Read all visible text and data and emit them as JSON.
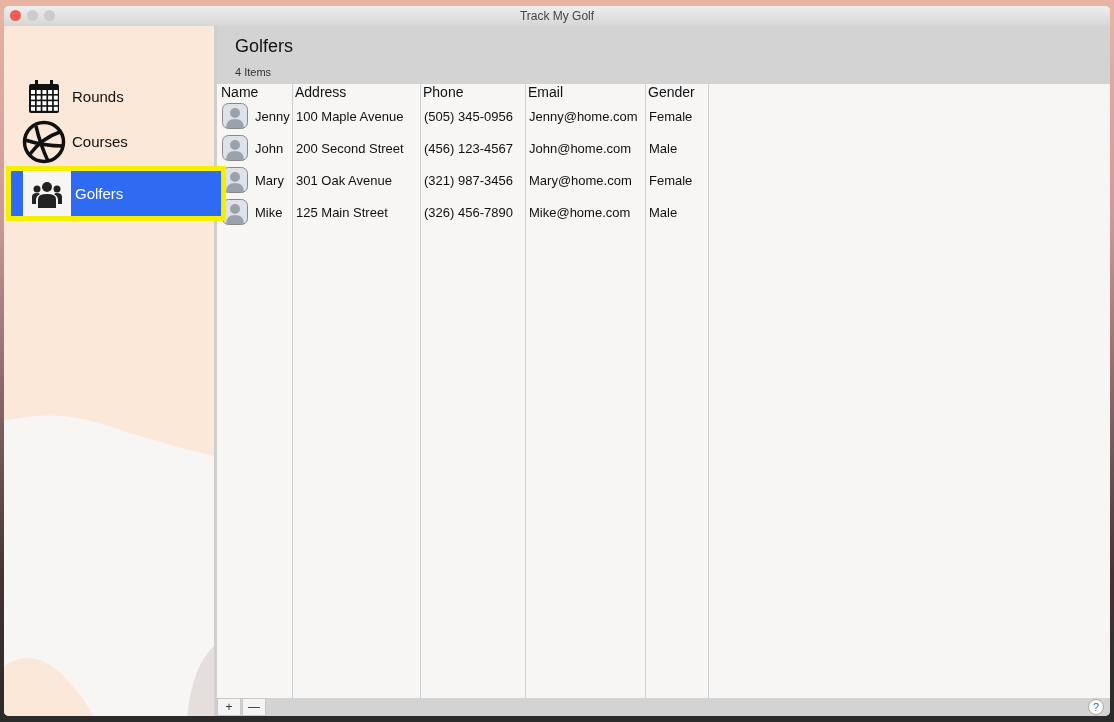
{
  "window": {
    "title": "Track My Golf"
  },
  "sidebar": {
    "items": [
      {
        "label": "Rounds",
        "selected": false
      },
      {
        "label": "Courses",
        "selected": false
      },
      {
        "label": "Golfers",
        "selected": true
      }
    ]
  },
  "header": {
    "title": "Golfers",
    "subtitle": "4 Items"
  },
  "table": {
    "columns": [
      "Name",
      "Address",
      "Phone",
      "Email",
      "Gender"
    ],
    "rows": [
      {
        "cells": [
          "Jenny",
          "100 Maple Avenue",
          "(505) 345-0956",
          "Jenny@home.com",
          "Female"
        ]
      },
      {
        "cells": [
          "John",
          "200 Second Street",
          "(456) 123-4567",
          "John@home.com",
          "Male"
        ]
      },
      {
        "cells": [
          "Mary",
          "301 Oak Avenue",
          "(321) 987-3456",
          "Mary@home.com",
          "Female"
        ]
      },
      {
        "cells": [
          "Mike",
          "125 Main Street",
          "(326) 456-7890",
          "Mike@home.com",
          "Male"
        ]
      }
    ]
  },
  "footer": {
    "buttons": [
      "+",
      "—"
    ],
    "help": "?"
  }
}
